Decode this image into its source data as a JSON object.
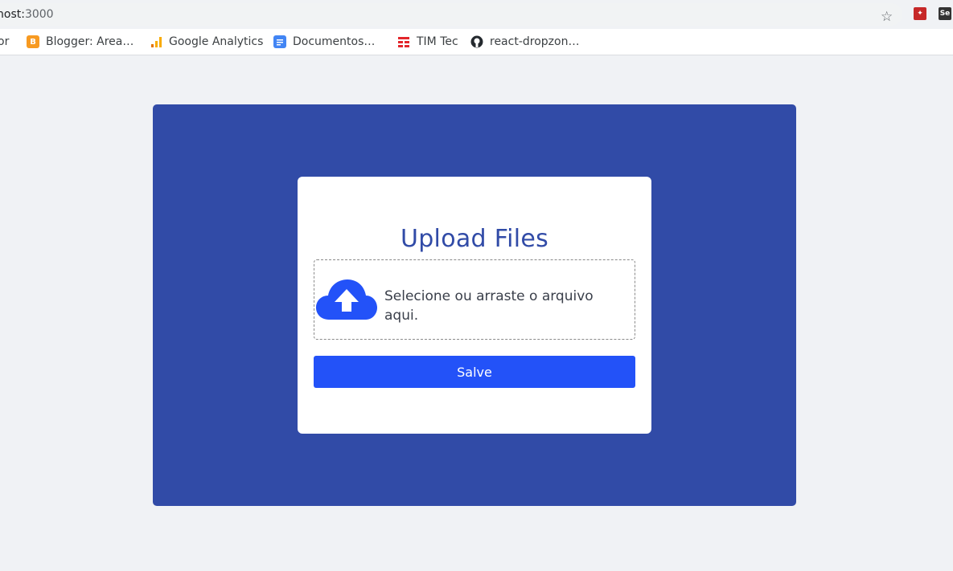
{
  "browser": {
    "url_host": "host:",
    "url_port": "3000",
    "bookmarks": [
      {
        "label": "or",
        "icon": "bookmark-partial-icon"
      },
      {
        "label": "Blogger: Area…",
        "icon": "blogger-icon",
        "color": "#f79a21"
      },
      {
        "label": "Google Analytics",
        "icon": "analytics-icon",
        "color": "#f9ab00"
      },
      {
        "label": "Documentos…",
        "icon": "docs-icon",
        "color": "#4285f4"
      },
      {
        "label": "TIM Tec",
        "icon": "timtec-icon",
        "color": "#e3262b"
      },
      {
        "label": "react-dropzon…",
        "icon": "github-icon",
        "color": "#24292e"
      }
    ],
    "extensions": [
      {
        "icon": "extension-red-icon"
      },
      {
        "icon": "selenium-extension-icon",
        "label": "Se"
      }
    ]
  },
  "upload": {
    "title": "Upload Files",
    "dropzone_text": "Selecione ou arraste o arquivo aqui.",
    "save_label": "Salve"
  },
  "colors": {
    "panel": "#314ba7",
    "button": "#2352f8",
    "cloud": "#2352f8",
    "background": "#f0f2f5"
  }
}
